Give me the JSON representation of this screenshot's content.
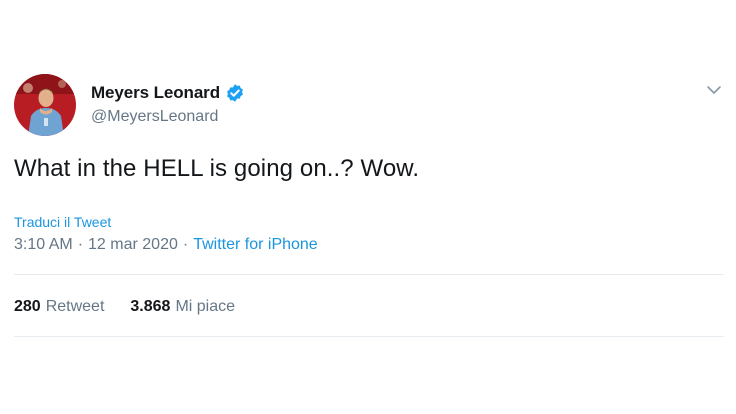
{
  "user": {
    "display_name": "Meyers Leonard",
    "handle": "@MeyersLeonard",
    "verified": true,
    "avatar_icon": "avatar-photo"
  },
  "tweet": {
    "text": "What in the HELL is going on..? Wow.",
    "translate_label": "Traduci il Tweet",
    "time": "3:10 AM",
    "date": "12 mar 2020",
    "separator": "·",
    "source": "Twitter for iPhone"
  },
  "stats": {
    "retweets_count": "280",
    "retweets_label": "Retweet",
    "likes_count": "3.868",
    "likes_label": "Mi piace"
  },
  "colors": {
    "link": "#1b95e0",
    "text": "#14171a",
    "secondary": "#657786",
    "divider": "#e6ecf0",
    "verified": "#1da1f2"
  },
  "icons": {
    "verified": "verified-badge-icon",
    "menu": "chevron-down-icon"
  }
}
